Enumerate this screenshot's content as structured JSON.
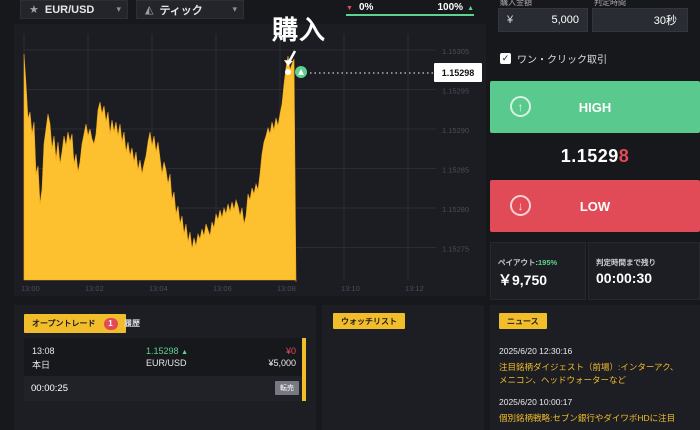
{
  "toolbar": {
    "pair": "EUR/USD",
    "chart_type": "ティック",
    "ratio_left": "0%",
    "ratio_right": "100%"
  },
  "chart": {
    "buy_label": "購入",
    "current_price_tag": "1.15298",
    "y_ticks": [
      "1.15305",
      "1.15295",
      "1.15290",
      "1.15285",
      "1.15280",
      "1.15275"
    ],
    "x_ticks": [
      "13:00",
      "13:02",
      "13:04",
      "13:06",
      "13:08",
      "13:10",
      "13:12"
    ],
    "colors": {
      "area": "#fdc02f",
      "entry_marker": "#5fd08f",
      "background": "#1c1d22"
    }
  },
  "trade": {
    "amount_label": "購入金額",
    "amount_currency": "¥",
    "amount_value": "5,000",
    "time_label": "判定時間",
    "time_value": "30秒",
    "one_click_label": "ワン・クリック取引",
    "one_click_checked": true,
    "high_label": "HIGH",
    "low_label": "LOW",
    "price_main": "1.1529",
    "price_last_digit": "8",
    "payout_label": "ペイアウト:",
    "payout_rate": "195%",
    "payout_value": "￥9,750",
    "remaining_label": "判定時間まで残り",
    "remaining_value": "00:00:30"
  },
  "open_trades": {
    "tab_label": "オープントレード",
    "count": "1",
    "history_label": "履歴",
    "item": {
      "time": "13:08",
      "day": "本日",
      "price": "1.15298",
      "pair": "EUR/USD",
      "profit": "¥0",
      "amount": "¥5,000",
      "countdown": "00:00:25",
      "sell_label": "転売"
    }
  },
  "watchlist": {
    "tab_label": "ウォッチリスト"
  },
  "news": {
    "tab_label": "ニュース",
    "items": [
      {
        "time": "2025/6/20 12:30:16",
        "title": "注目銘柄ダイジェスト（前場）:インターアク、メニコン、ヘッドウォーターなど"
      },
      {
        "time": "2025/6/20 10:00:17",
        "title": "個別銘柄戦略:セブン銀行やダイワボHDに注目"
      }
    ]
  }
}
